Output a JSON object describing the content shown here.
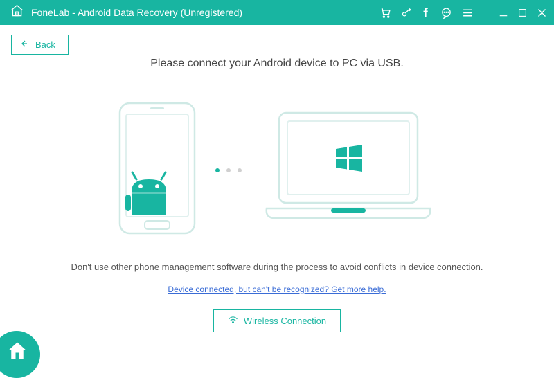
{
  "titlebar": {
    "title": "FoneLab - Android Data Recovery (Unregistered)"
  },
  "back": {
    "label": "Back"
  },
  "main": {
    "instruction": "Please connect your Android device to PC via USB.",
    "warning": "Don't use other phone management software during the process to avoid conflicts in device connection.",
    "help_link": "Device connected, but can't be recognized? Get more help.",
    "wireless_label": "Wireless Connection"
  },
  "colors": {
    "accent": "#18b5a1",
    "link": "#3a6cd6"
  }
}
